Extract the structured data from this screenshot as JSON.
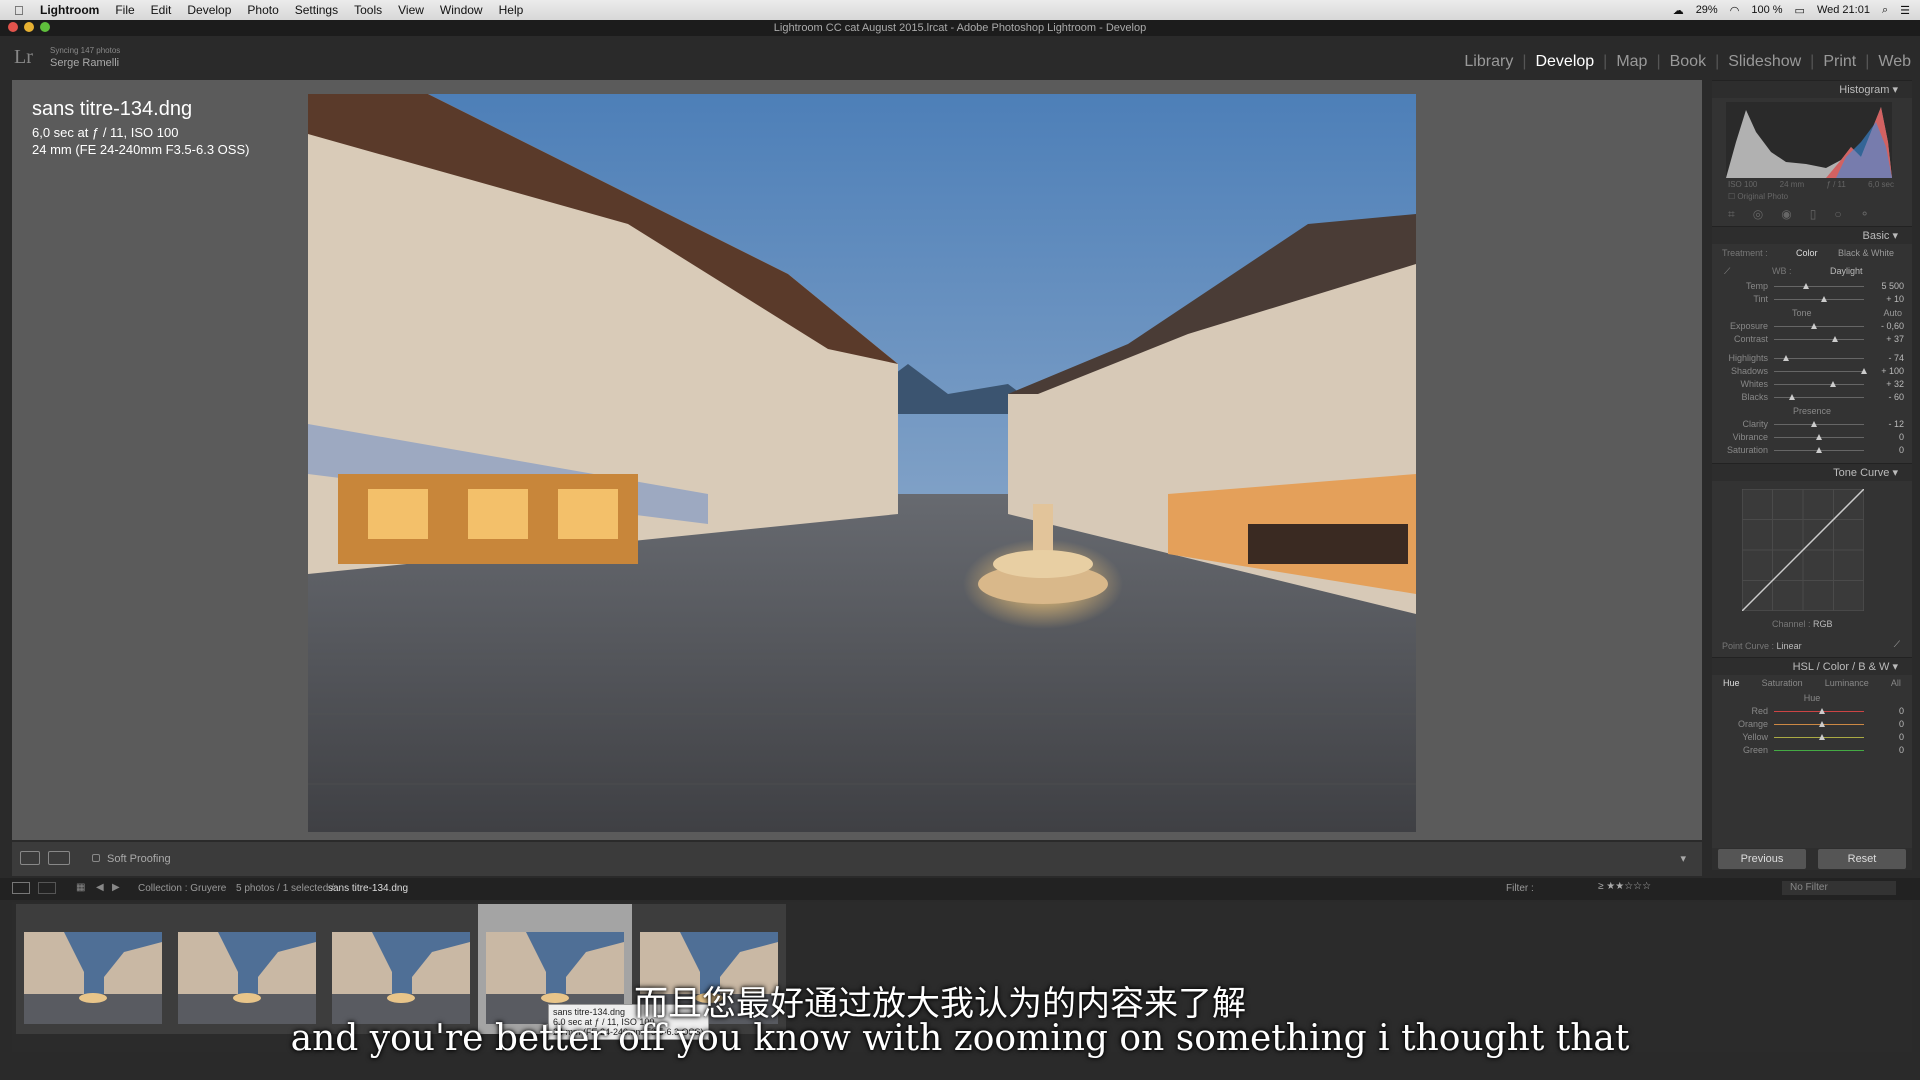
{
  "menubar": {
    "app": "Lightroom",
    "items": [
      "File",
      "Edit",
      "Develop",
      "Photo",
      "Settings",
      "Tools",
      "View",
      "Window",
      "Help"
    ],
    "status": [
      "29%",
      "100 %",
      "Wed 21:01"
    ]
  },
  "window": {
    "title": "Lightroom CC cat August 2015.lrcat - Adobe Photoshop Lightroom - Develop"
  },
  "identity": {
    "logo": "Lr",
    "sync": "Syncing 147 photos",
    "user": "Serge Ramelli"
  },
  "modules": [
    "Library",
    "Develop",
    "Map",
    "Book",
    "Slideshow",
    "Print",
    "Web"
  ],
  "active_module": "Develop",
  "photo_info": {
    "filename": "sans titre-134.dng",
    "exposure": "6,0 sec at ƒ / 11, ISO 100",
    "lens": "24 mm (FE 24-240mm F3.5-6.3 OSS)"
  },
  "toolbar": {
    "soft_proofing": "Soft Proofing"
  },
  "right_panel": {
    "histogram": {
      "title": "Histogram",
      "iso": "ISO 100",
      "focal": "24 mm",
      "aperture": "ƒ / 11",
      "shutter": "6,0 sec",
      "original_photo": "Original Photo"
    },
    "basic": {
      "title": "Basic",
      "treatment_label": "Treatment :",
      "treatment_color": "Color",
      "treatment_bw": "Black & White",
      "wb_label": "WB :",
      "wb_value": "Daylight",
      "temp": {
        "label": "Temp",
        "value": "5 500",
        "pos": 0.35
      },
      "tint": {
        "label": "Tint",
        "value": "+ 10",
        "pos": 0.55
      },
      "tone_label": "Tone",
      "auto": "Auto",
      "exposure": {
        "label": "Exposure",
        "value": "- 0,60",
        "pos": 0.44
      },
      "contrast": {
        "label": "Contrast",
        "value": "+ 37",
        "pos": 0.68
      },
      "highlights": {
        "label": "Highlights",
        "value": "- 74",
        "pos": 0.13
      },
      "shadows": {
        "label": "Shadows",
        "value": "+ 100",
        "pos": 1.0
      },
      "whites": {
        "label": "Whites",
        "value": "+ 32",
        "pos": 0.66
      },
      "blacks": {
        "label": "Blacks",
        "value": "- 60",
        "pos": 0.2
      },
      "presence_label": "Presence",
      "clarity": {
        "label": "Clarity",
        "value": "- 12",
        "pos": 0.44
      },
      "vibrance": {
        "label": "Vibrance",
        "value": "0",
        "pos": 0.5
      },
      "saturation": {
        "label": "Saturation",
        "value": "0",
        "pos": 0.5
      }
    },
    "tone_curve": {
      "title": "Tone Curve",
      "channel_label": "Channel :",
      "channel_value": "RGB",
      "point_curve_label": "Point Curve :",
      "point_curve_value": "Linear"
    },
    "hsl": {
      "title_hsl": "HSL",
      "title_color": "Color",
      "title_bw": "B & W",
      "tabs": [
        "Hue",
        "Saturation",
        "Luminance",
        "All"
      ],
      "hue_label": "Hue",
      "rows": [
        {
          "label": "Red",
          "value": "0"
        },
        {
          "label": "Orange",
          "value": "0"
        },
        {
          "label": "Yellow",
          "value": "0"
        },
        {
          "label": "Green",
          "value": "0"
        }
      ]
    },
    "buttons": {
      "previous": "Previous",
      "reset": "Reset"
    }
  },
  "filmstrip_bar": {
    "collection": "Collection : Gruyere",
    "count": "5 photos / 1 selected /",
    "selected_file": "sans titre-134.dng",
    "filter_label": "Filter :",
    "filter_value": "No Filter"
  },
  "filmstrip": {
    "selected_index": 3,
    "count": 5
  },
  "tooltip": {
    "line1": "sans titre-134.dng",
    "line2": "6,0 sec at ƒ / 11, ISO 100",
    "line3": "24 mm (FE 24-240mm F3.5-6.3 OSS)"
  },
  "subtitles": {
    "zh": "而且您最好通过放大我认为的内容来了解",
    "en": "and you're better off you know with zooming on something i thought that"
  },
  "colors": {
    "accent_active": "#ffffff",
    "panel_bg": "#333333",
    "canvas_bg": "#5b5b5b"
  }
}
